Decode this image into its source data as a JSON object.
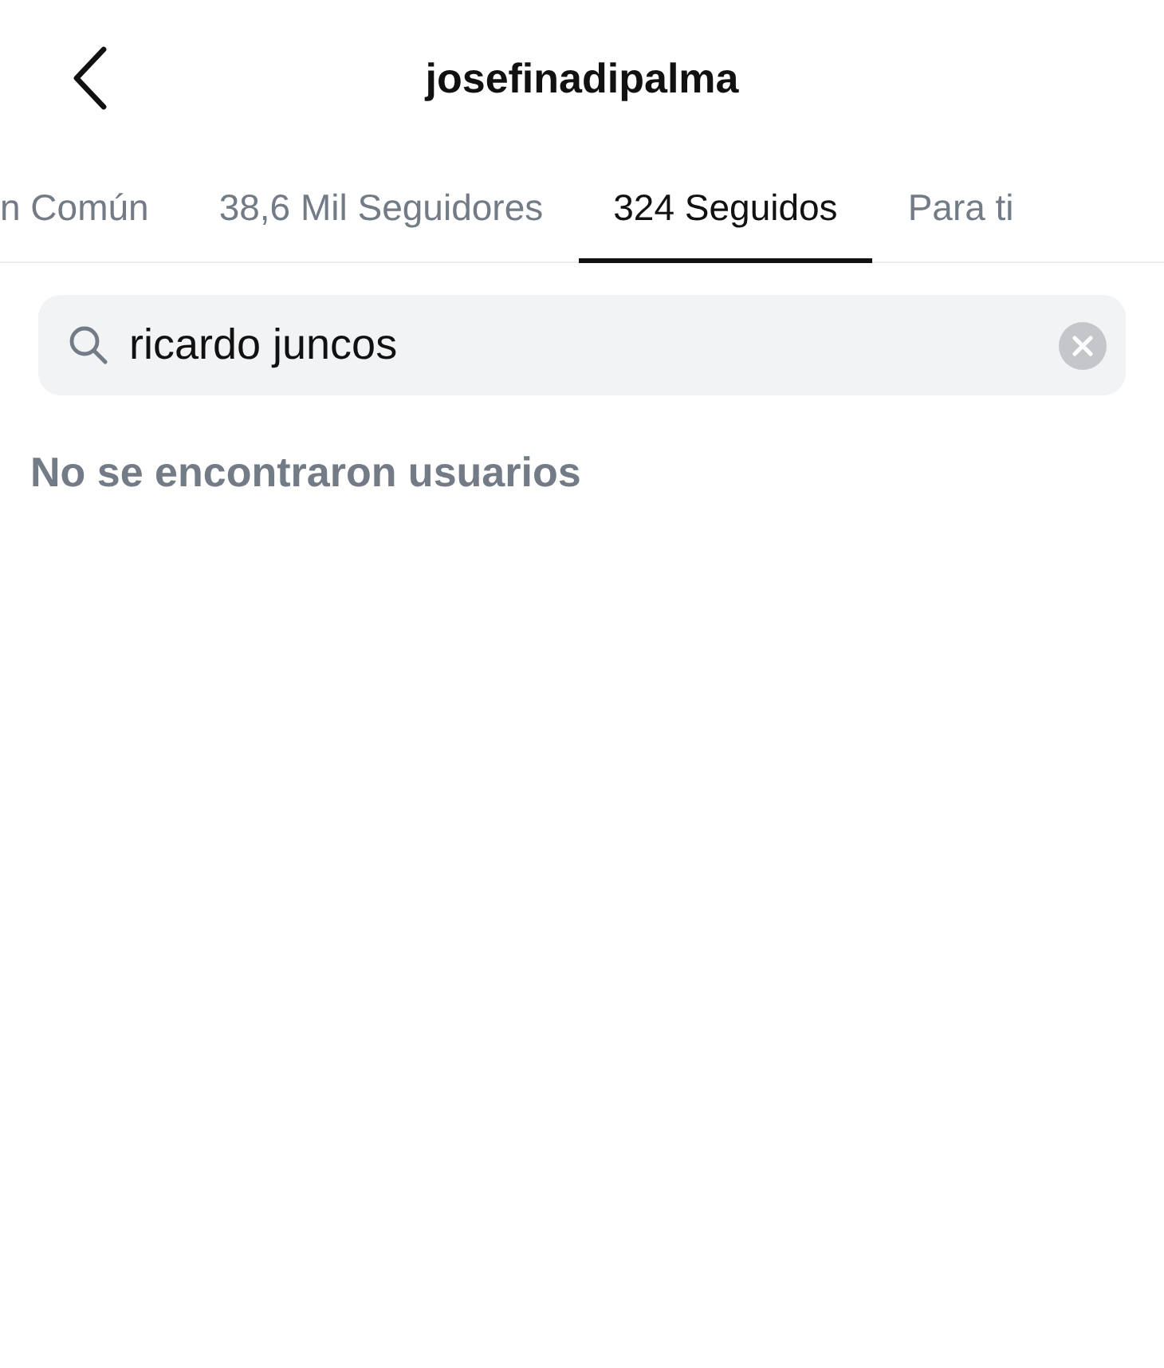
{
  "header": {
    "title": "josefinadipalma"
  },
  "tabs": [
    {
      "label": "n Común",
      "selected": false
    },
    {
      "label": "38,6 Mil Seguidores",
      "selected": false
    },
    {
      "label": "324 Seguidos",
      "selected": true
    },
    {
      "label": "Para ti",
      "selected": false
    }
  ],
  "search": {
    "value": "ricardo juncos"
  },
  "message": "No se encontraron usuarios"
}
